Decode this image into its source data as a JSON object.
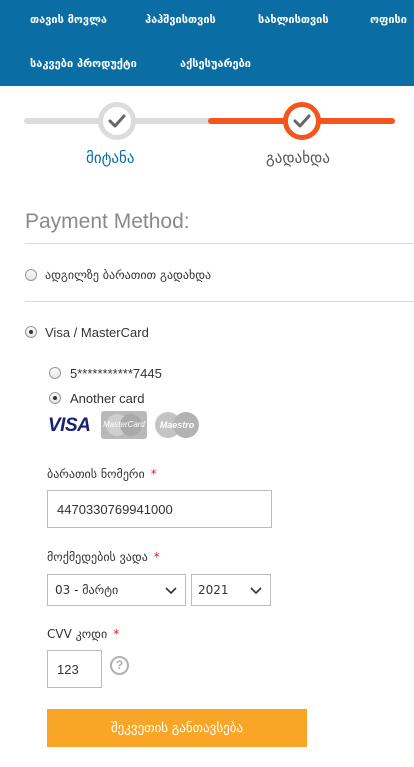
{
  "nav": {
    "items": [
      "თავის მოვლა",
      "ჰაჰშვისთვის",
      "სახლისთვის",
      "ოფისი",
      "საკვები პროდუქტი",
      "აქსესუარები"
    ]
  },
  "stepper": {
    "step1": "მიტანა",
    "step2": "გადახდა",
    "colors": {
      "done": "#dcdcdc",
      "active": "#f2561d"
    }
  },
  "payment": {
    "title": "Payment Method:",
    "options": {
      "cash": "ადგილზე ბარათით გადახდა",
      "card": "Visa / MasterCard"
    },
    "saved_card": "5***********7445",
    "another_card": "Another card",
    "logos": {
      "visa": "VISA",
      "mastercard": "MasterCard",
      "maestro": "Maestro"
    }
  },
  "form": {
    "card_number_label": "ბარათის ნომერი",
    "card_number_value": "4470330769941000",
    "expiry_label": "მოქმედების ვადა",
    "expiry_month": "03 - მარტი",
    "expiry_year": "2021",
    "cvv_label": "CVV კოდი",
    "cvv_value": "123",
    "required_mark": "*",
    "help_glyph": "?",
    "submit_label": "შეკვეთის განთავსება"
  },
  "colors": {
    "nav_bg": "#0a6da3",
    "accent": "#f2561d",
    "button": "#f9a526"
  }
}
